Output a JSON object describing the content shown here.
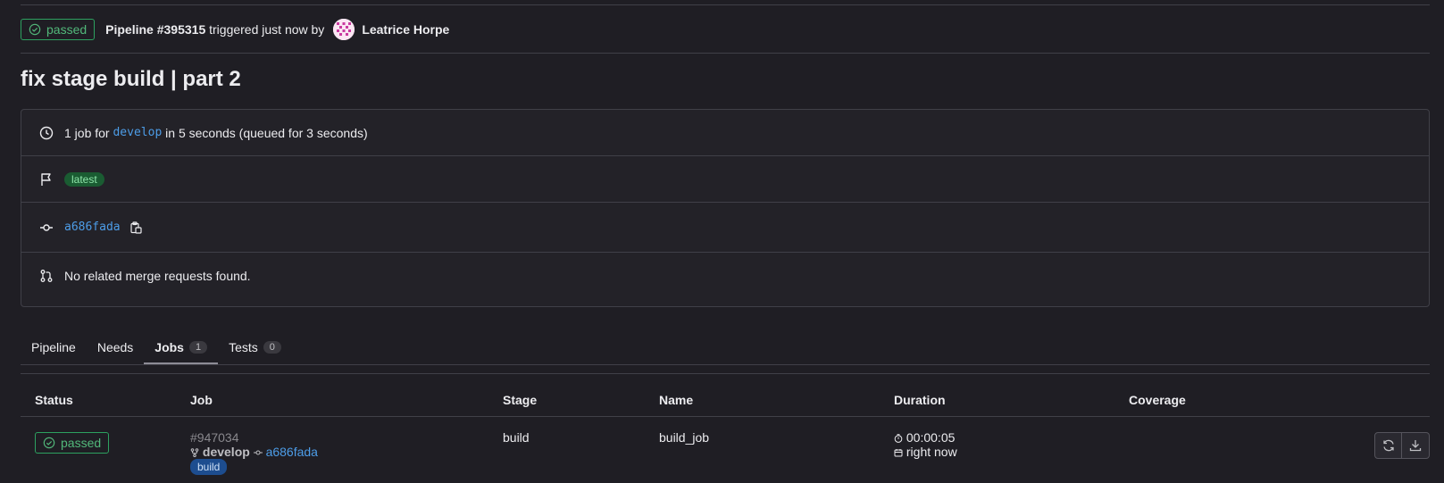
{
  "header": {
    "status": "passed",
    "pipeline_label": "Pipeline #395315",
    "triggered_text": "triggered just now by",
    "user_name": "Leatrice Horpe"
  },
  "title": "fix stage build | part 2",
  "info": {
    "jobs_prefix": "1 job for",
    "branch": "develop",
    "jobs_suffix": "in 5 seconds (queued for 3 seconds)",
    "tag_latest": "latest",
    "commit_sha": "a686fada",
    "merge_requests": "No related merge requests found."
  },
  "tabs": [
    {
      "label": "Pipeline"
    },
    {
      "label": "Needs"
    },
    {
      "label": "Jobs",
      "count": "1"
    },
    {
      "label": "Tests",
      "count": "0"
    }
  ],
  "table": {
    "columns": [
      "Status",
      "Job",
      "Stage",
      "Name",
      "Duration",
      "Coverage"
    ],
    "rows": [
      {
        "status": "passed",
        "job_id": "#947034",
        "branch": "develop",
        "commit": "a686fada",
        "stage_tag": "build",
        "stage": "build",
        "name": "build_job",
        "duration": "00:00:05",
        "finished": "right now",
        "coverage": ""
      }
    ]
  },
  "colors": {
    "success": "#52b87a",
    "link": "#4d9de8",
    "background": "#1f1e24"
  }
}
